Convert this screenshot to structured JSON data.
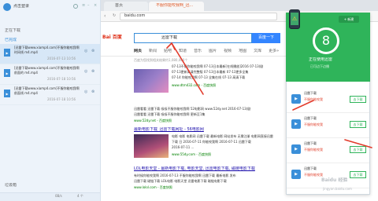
{
  "app": {
    "login_label": "点击登录",
    "tab_downloading": "正在下载",
    "tab_completed": "已完成",
    "tab_trash": "垃圾箱",
    "tasks": [
      {
        "name": "[迅雷下载www.xiamp4.com]不服你能咬我啊",
        "name2": "时间线 m4.mp4",
        "date": "2016-07-13 10:56"
      },
      {
        "name": "[迅雷下载www.xiamp4.com]不服你能咬我啊",
        "name2": "前面的 m4.mp4",
        "date": "2016-07-18 10:56"
      },
      {
        "name": "[迅雷下载www.xiamp4.com]不服你能咬我啊",
        "name2": "前面线 m4.mp4",
        "date": "2016-07-18 10:56"
      }
    ],
    "footer_speed": "0B/s",
    "footer_count": "4 个"
  },
  "browser": {
    "tab_home": "首页",
    "tab_active": "不服你能咬我啊_迅...",
    "address": "baidu.com",
    "search_query": "迅雷下载",
    "search_button": "百度一下",
    "logo_text": "Bai 百度",
    "nav": [
      "网页",
      "新闻",
      "贴吧",
      "知道",
      "音乐",
      "图片",
      "视频",
      "地图",
      "文库",
      "更多»"
    ],
    "result_meta": "百度为您找到相关结果约1,080,000个",
    "results": [
      {
        "title": "迅雷下载 [不服你能咬我啊] 迅雷下载 - 迅雷...",
        "l1": "07-13不服你能咬我啊 07-13日本最新[在线播放]2016 07-13(剧",
        "l2": "07-13更新高清完整版 07-13日本最新 07-13更多全集",
        "l3": "07-14 你能咬我啊 07-13 全集在线 07-13 高清下载",
        "url": "www.dtm432.com - 百度快照"
      },
      {
        "title": "迅雷看看 不服你能咬我啊 迅雷下载 - 52dy...",
        "l1": "迅雷看看 迅雷下载 吸吸不服你能咬我啊 52电影网 www.52dy.net 2016-07-13(剧",
        "l2": "迅雷看看 迅雷下载 吸吸不服你能咬我啊 更新至1集",
        "l3": "",
        "url": "www.52dy.net - 百度快照"
      },
      {
        "title": "最新电影下载_迅雷下载网址 - 56电影网",
        "l1": "电影 电影 电影网 迅雷下载 最新电影 网站发布 无需注册 电影网直接迅雷",
        "l2": "下载 日 2016-07-11 你能咬我啊 2016-07-11 迅雷下载",
        "l3": "2016-07-11 ...",
        "url": "www.55dy.com - 百度快照"
      },
      {
        "title": "LOL电影天堂 - 最新电影下载, 电影天堂, 迅雷电影下载, 磁链电影下载",
        "l1": "有时候你能咬我啊 2016-07-13 不服你能咬我啊 迅雷下载 最新电影 发布",
        "l2": "迅雷下载 磁链下载 LOL电影 电影天堂 迅雷电影下载 磁链电影下载",
        "l3": "",
        "url": "www.lolol.com - 百度快照"
      }
    ]
  },
  "popup": {
    "new_task": "+ 新建",
    "count": "8",
    "label": "正在使用迅雷",
    "subtitle": "已可边下边播",
    "items": [
      {
        "name": "迅雷下载",
        "sub": "不服你能咬我",
        "button": "去下载"
      },
      {
        "name": "迅雷下载",
        "sub": "不服你能咬我",
        "button": "去下载"
      },
      {
        "name": "迅雷下载",
        "sub": "不服你能咬我",
        "button": "去下载"
      },
      {
        "name": "迅雷下载",
        "sub": "不服你能咬我",
        "button": "去下载"
      }
    ]
  },
  "watermark": "Baidu 经验",
  "watermark_url": "jingyan.baidu.com",
  "colors": {
    "accent": "#2fb45a",
    "xunlei_blue": "#3a8fd9",
    "link": "#1a0dab",
    "url_green": "#008000",
    "arrow": "#e23b2c"
  }
}
